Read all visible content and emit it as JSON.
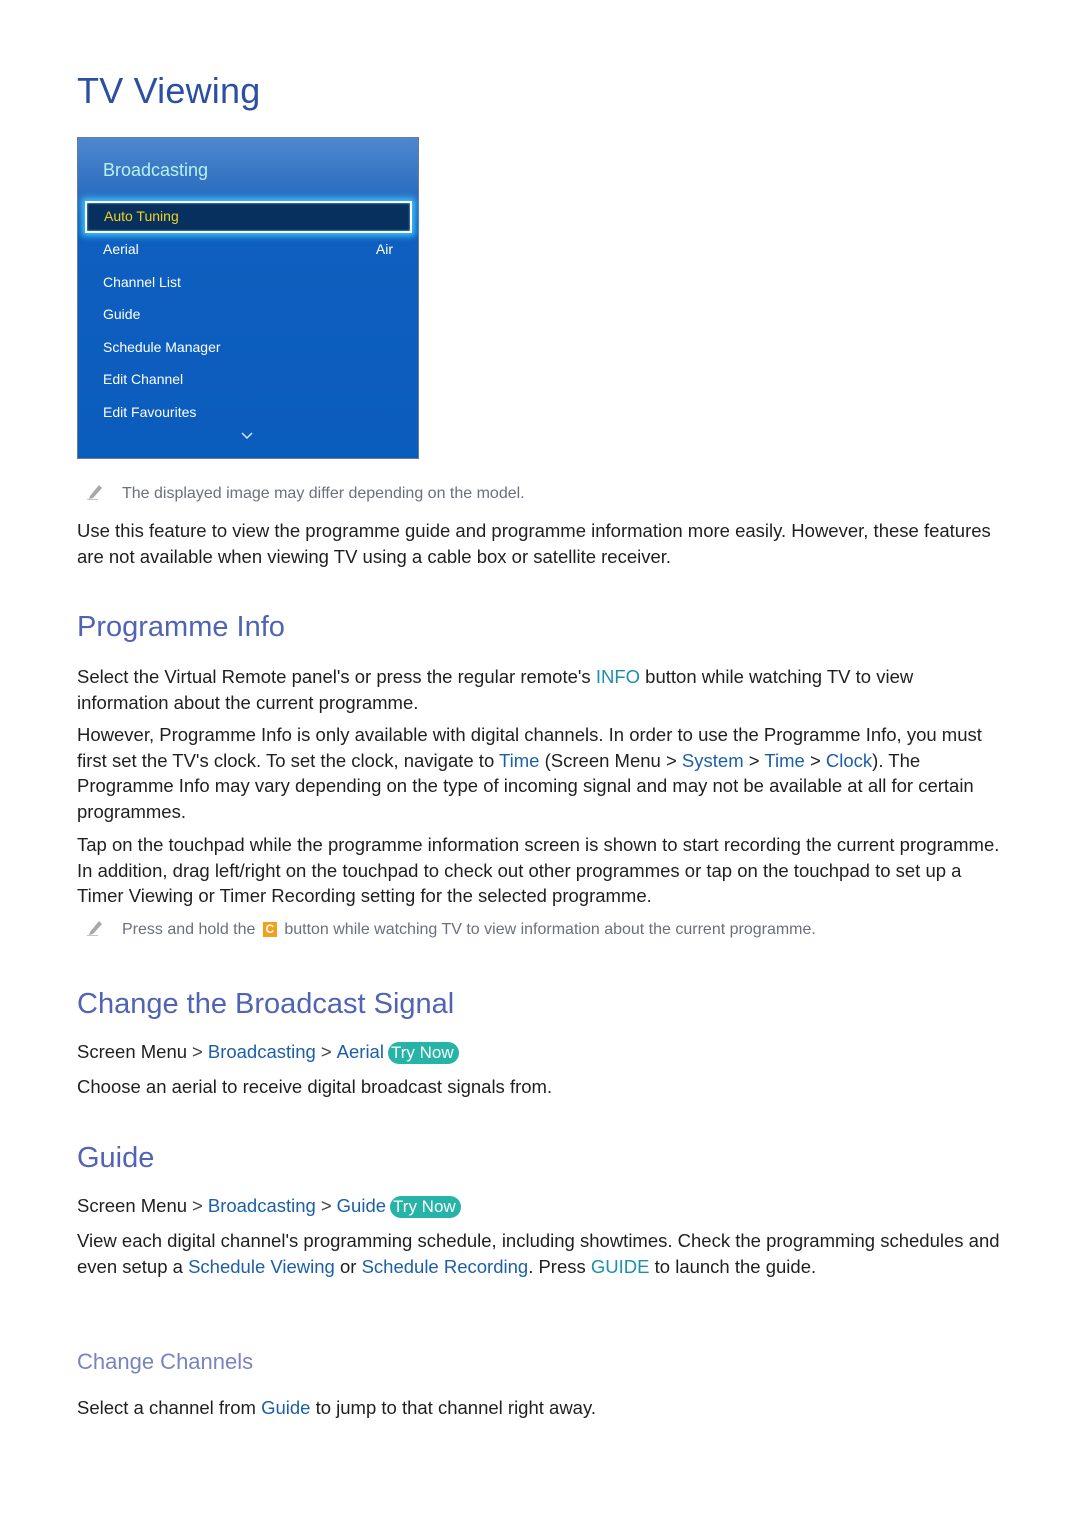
{
  "page": {
    "title": "TV Viewing"
  },
  "tv_menu": {
    "header": "Broadcasting",
    "selected_item": "Auto Tuning",
    "items": [
      {
        "label": "Aerial",
        "value": "Air"
      },
      {
        "label": "Channel List",
        "value": ""
      },
      {
        "label": "Guide",
        "value": ""
      },
      {
        "label": "Schedule Manager",
        "value": ""
      },
      {
        "label": "Edit Channel",
        "value": ""
      },
      {
        "label": "Edit Favourites",
        "value": ""
      }
    ],
    "more_icon": "chevron-down-icon"
  },
  "notes": {
    "image_note": "The displayed image may differ depending on the model.",
    "icon": "pencil-icon"
  },
  "intro": {
    "text": "Use this feature to view the programme guide and programme information more easily. However, these features are not available when viewing TV using a cable box or satellite receiver."
  },
  "programme_info": {
    "heading": "Programme Info",
    "p1_a": "Select the Virtual Remote panel's or press the regular remote's ",
    "p1_key": "INFO",
    "p1_b": " button while watching TV to view information about the current programme.",
    "p2_a": "However, Programme Info is only available with digital channels. In order to use the Programme Info, you must first set the TV's clock. To set the clock, navigate to ",
    "p2_time": "Time",
    "p2_b": " (Screen Menu",
    "p2_sep": ">",
    "p2_system": "System",
    "p2_time2": "Time",
    "p2_clock": "Clock",
    "p2_c": "). The Programme Info may vary depending on the type of incoming signal and may not be available at all for certain programmes.",
    "p3": "Tap on the touchpad while the programme information screen is shown to start recording the current programme. In addition, drag left/right on the touchpad to check out other programmes or tap on the touchpad to set up a Timer Viewing or Timer Recording setting for the selected programme.",
    "note_a": "Press and hold the ",
    "note_key": "C",
    "note_b": " button while watching TV to view information about the current programme."
  },
  "broadcast_signal": {
    "heading": "Change the Broadcast Signal",
    "path": [
      "Screen Menu",
      "Broadcasting",
      "Aerial"
    ],
    "try_now": "Try Now",
    "text": "Choose an aerial to receive digital broadcast signals from."
  },
  "guide": {
    "heading": "Guide",
    "path": [
      "Screen Menu",
      "Broadcasting",
      "Guide"
    ],
    "try_now": "Try Now",
    "text_a": "View each digital channel's programming schedule, including showtimes. Check the programming schedules and even setup a ",
    "link1": "Schedule Viewing",
    "text_b": " or ",
    "link2": "Schedule Recording",
    "text_c": ". Press ",
    "key": "GUIDE",
    "text_d": " to launch the guide."
  },
  "change_channels": {
    "heading": "Change Channels",
    "text_a": "Select a channel from ",
    "link": "Guide",
    "text_b": " to jump to that channel right away."
  },
  "colors": {
    "title": "#2b4fa2",
    "section_heading": "#5063b5",
    "link": "#1b5fa8",
    "key": "#1a8fb0",
    "try_now": "#26b3a8",
    "c_button": "#f3a11a",
    "menu_selected_text": "#f2d21c"
  }
}
